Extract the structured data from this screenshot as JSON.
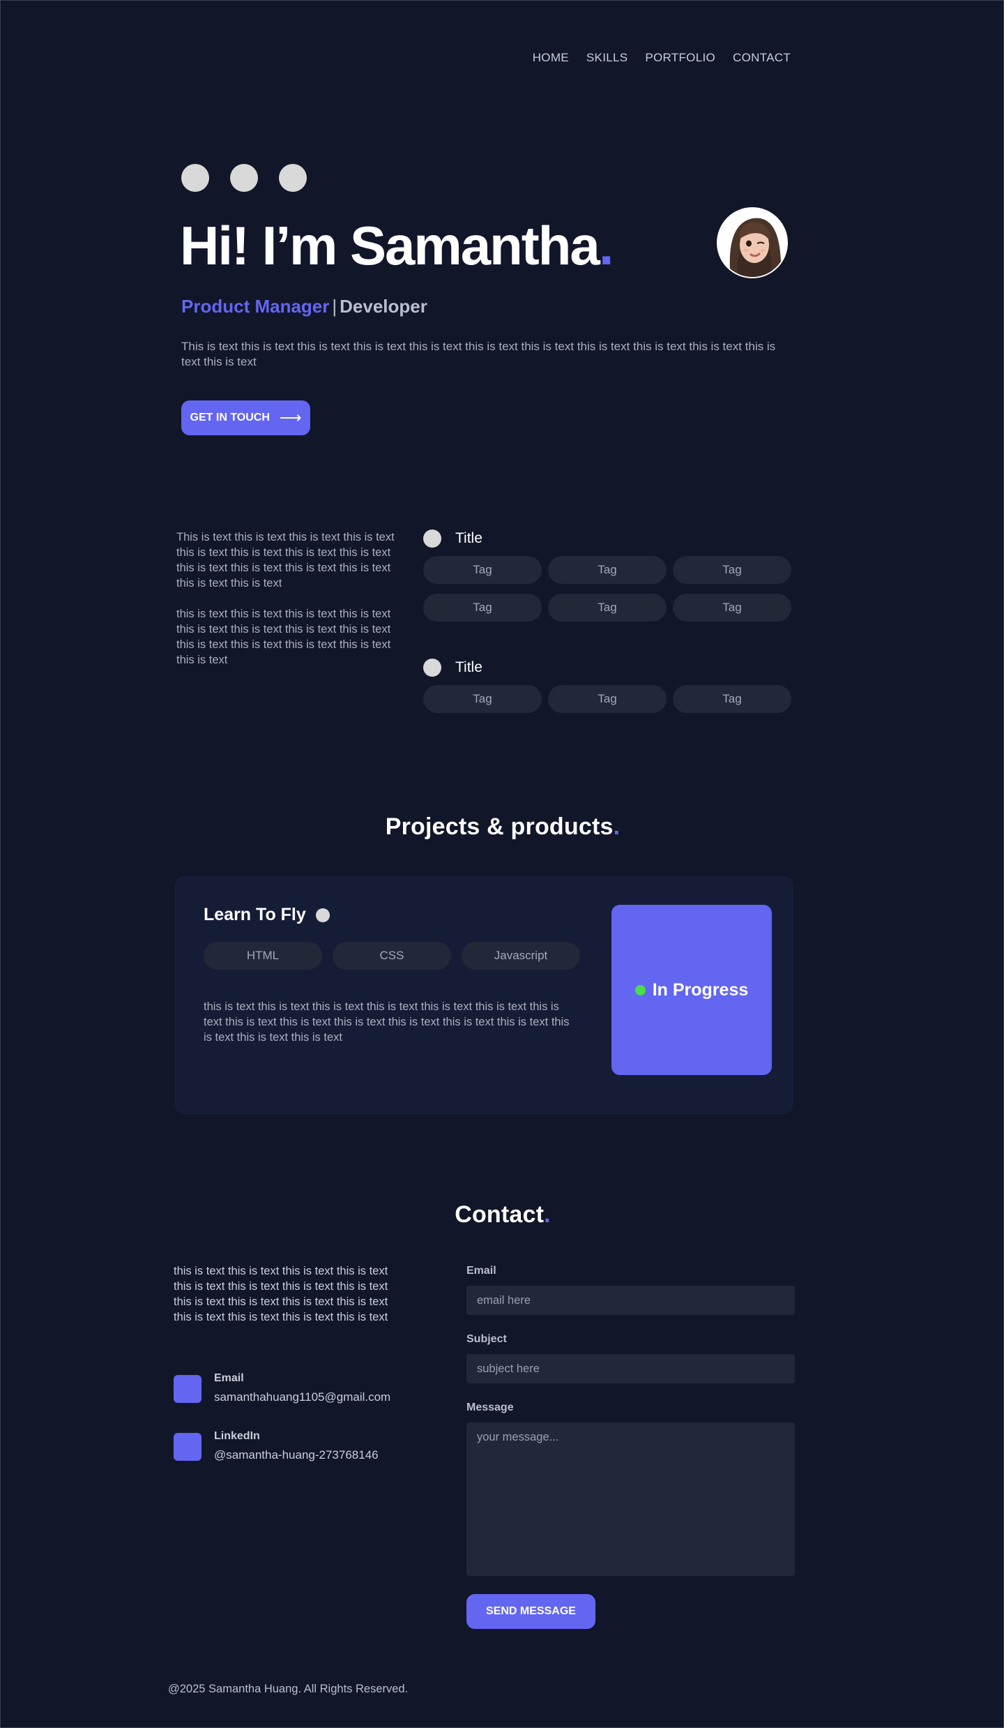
{
  "nav": {
    "items": [
      "HOME",
      "SKILLS",
      "PORTFOLIO",
      "CONTACT"
    ]
  },
  "hero": {
    "title": "Hi! I’m Samantha",
    "title_accent": ".",
    "role_primary": "Product Manager",
    "role_separator": "|",
    "role_secondary": "Developer",
    "text": "This is text this is text this is text this is text this is text this is text this is text this is text this is text this is text this is text this is text",
    "cta_label": "GET IN TOUCH",
    "cta_arrow": "⟶"
  },
  "about": {
    "paragraphs": [
      "This is text this is text this is text this is text this is text this is text this is text this is text this is text this is text this is text this is text this is text this is text",
      "this is text this is text this is text this is text this is text this is text this is text this is text this is text this is text this is text this is text this is text"
    ]
  },
  "skills": [
    {
      "title": "Title",
      "tags": [
        "Tag",
        "Tag",
        "Tag",
        "Tag",
        "Tag",
        "Tag"
      ]
    },
    {
      "title": "Title",
      "tags": [
        "Tag",
        "Tag",
        "Tag"
      ]
    }
  ],
  "projects": {
    "title": "Projects & products",
    "title_accent": ".",
    "items": [
      {
        "name": "Learn To Fly",
        "tags": [
          "HTML",
          "CSS",
          "Javascript"
        ],
        "description": "this is text this is text this is text this is text this is text this is text this is text this is text this is text this is text this is text this is text this is text this is text this is text this is text",
        "status": "In Progress",
        "status_color": "#4ade4a"
      }
    ]
  },
  "contact": {
    "title": "Contact",
    "title_accent": ".",
    "text": "this is text this is text this is text this is text this is text this is text this is text this is text this is text this is text this is text this is text this is text this is text this is text this is text",
    "items": [
      {
        "label": "Email",
        "value": "samanthahuang1105@gmail.com",
        "icon": "mail-icon"
      },
      {
        "label": "LinkedIn",
        "value": "@samantha-huang-273768146",
        "icon": "linkedin-icon"
      }
    ],
    "form": {
      "email_label": "Email",
      "email_placeholder": "email here",
      "subject_label": "Subject",
      "subject_placeholder": "subject here",
      "message_label": "Message",
      "message_placeholder": "your message...",
      "submit_label": "SEND MESSAGE"
    }
  },
  "footer": {
    "text": "@2025 Samantha Huang. All Rights Reserved."
  },
  "colors": {
    "background": "#111629",
    "accent": "#6366f1",
    "card": "#151c36",
    "tag": "#222838",
    "status_green": "#4ade4a"
  }
}
